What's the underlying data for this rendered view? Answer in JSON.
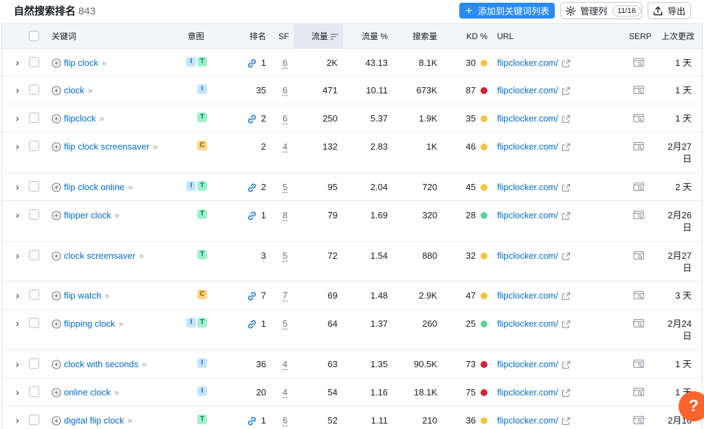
{
  "header": {
    "title": "自然搜索排名",
    "count": "843",
    "add_button": "添加到关键词列表",
    "manage_button": "管理列",
    "manage_pill": "11/16",
    "export_button": "导出"
  },
  "columns": {
    "keyword": "关键词",
    "intent": "意图",
    "rank": "排名",
    "sf": "SF",
    "traffic": "流量",
    "traffic_pct": "流量 %",
    "volume": "搜索量",
    "kd": "KD %",
    "url": "URL",
    "serp": "SERP",
    "updated": "上次更改"
  },
  "colors": {
    "accent": "#2b8bf2",
    "link": "#006dca",
    "kd_yellow": "#f5c443",
    "kd_red": "#d1222f",
    "kd_green": "#59d39a",
    "help": "#ff642d"
  },
  "icons": {
    "expand": "chevron-right-icon",
    "add_keyword": "plus-circle-icon",
    "rank_link": "link-icon",
    "url_external": "external-link-icon",
    "serp": "serp-preview-icon",
    "help": "question-icon"
  },
  "rows": [
    {
      "keyword": "flip clock",
      "intents": [
        "I",
        "T"
      ],
      "has_link": true,
      "rank": "1",
      "sf": "6",
      "traffic": "2K",
      "traffic_pct": "43.13",
      "volume": "8.1K",
      "kd": "30",
      "kd_color": "#f5c443",
      "url": "flipclocker.com/",
      "updated": [
        "1 天"
      ]
    },
    {
      "keyword": "clock",
      "intents": [
        "I"
      ],
      "has_link": false,
      "rank": "35",
      "sf": "6",
      "traffic": "471",
      "traffic_pct": "10.11",
      "volume": "673K",
      "kd": "87",
      "kd_color": "#d1222f",
      "url": "flipclocker.com/",
      "updated": [
        "1 天"
      ]
    },
    {
      "keyword": "flipclock",
      "intents": [
        "T"
      ],
      "has_link": true,
      "rank": "2",
      "sf": "6",
      "traffic": "250",
      "traffic_pct": "5.37",
      "volume": "1.9K",
      "kd": "35",
      "kd_color": "#f5c443",
      "url": "flipclocker.com/",
      "updated": [
        "1 天"
      ]
    },
    {
      "keyword": "flip clock screensaver",
      "intents": [
        "C"
      ],
      "has_link": false,
      "rank": "2",
      "sf": "4",
      "traffic": "132",
      "traffic_pct": "2.83",
      "volume": "1K",
      "kd": "46",
      "kd_color": "#f5c443",
      "url": "flipclocker.com/",
      "updated": [
        "2月27",
        "日"
      ]
    },
    {
      "keyword": "flip clock online",
      "intents": [
        "I",
        "T"
      ],
      "has_link": true,
      "rank": "2",
      "sf": "5",
      "traffic": "95",
      "traffic_pct": "2.04",
      "volume": "720",
      "kd": "45",
      "kd_color": "#f5c443",
      "url": "flipclocker.com/",
      "updated": [
        "2 天"
      ]
    },
    {
      "keyword": "flipper clock",
      "intents": [
        "T"
      ],
      "has_link": true,
      "rank": "1",
      "sf": "8",
      "traffic": "79",
      "traffic_pct": "1.69",
      "volume": "320",
      "kd": "28",
      "kd_color": "#59d39a",
      "url": "flipclocker.com/",
      "updated": [
        "2月26",
        "日"
      ]
    },
    {
      "keyword": "clock screensaver",
      "intents": [
        "T"
      ],
      "has_link": false,
      "rank": "3",
      "sf": "5",
      "traffic": "72",
      "traffic_pct": "1.54",
      "volume": "880",
      "kd": "32",
      "kd_color": "#f5c443",
      "url": "flipclocker.com/",
      "updated": [
        "2月27",
        "日"
      ]
    },
    {
      "keyword": "flip watch",
      "intents": [
        "C"
      ],
      "has_link": true,
      "rank": "7",
      "sf": "7",
      "traffic": "69",
      "traffic_pct": "1.48",
      "volume": "2.9K",
      "kd": "47",
      "kd_color": "#f5c443",
      "url": "flipclocker.com/",
      "updated": [
        "3 天"
      ]
    },
    {
      "keyword": "flipping clock",
      "intents": [
        "I",
        "T"
      ],
      "has_link": true,
      "rank": "1",
      "sf": "5",
      "traffic": "64",
      "traffic_pct": "1.37",
      "volume": "260",
      "kd": "25",
      "kd_color": "#59d39a",
      "url": "flipclocker.com/",
      "updated": [
        "2月24",
        "日"
      ]
    },
    {
      "keyword": "clock with seconds",
      "intents": [
        "I"
      ],
      "has_link": false,
      "rank": "36",
      "sf": "4",
      "traffic": "63",
      "traffic_pct": "1.35",
      "volume": "90.5K",
      "kd": "73",
      "kd_color": "#d1222f",
      "url": "flipclocker.com/",
      "updated": [
        "1 天"
      ]
    },
    {
      "keyword": "online clock",
      "intents": [
        "I"
      ],
      "has_link": false,
      "rank": "20",
      "sf": "4",
      "traffic": "54",
      "traffic_pct": "1.16",
      "volume": "18.1K",
      "kd": "75",
      "kd_color": "#d1222f",
      "url": "flipclocker.com/",
      "updated": [
        "1 天"
      ]
    },
    {
      "keyword": "digital flip clock",
      "intents": [
        "T"
      ],
      "has_link": true,
      "rank": "1",
      "sf": "6",
      "traffic": "52",
      "traffic_pct": "1.11",
      "volume": "210",
      "kd": "36",
      "kd_color": "#f5c443",
      "url": "flipclocker.com/",
      "updated": [
        "2月16"
      ]
    }
  ],
  "help_label": "?"
}
